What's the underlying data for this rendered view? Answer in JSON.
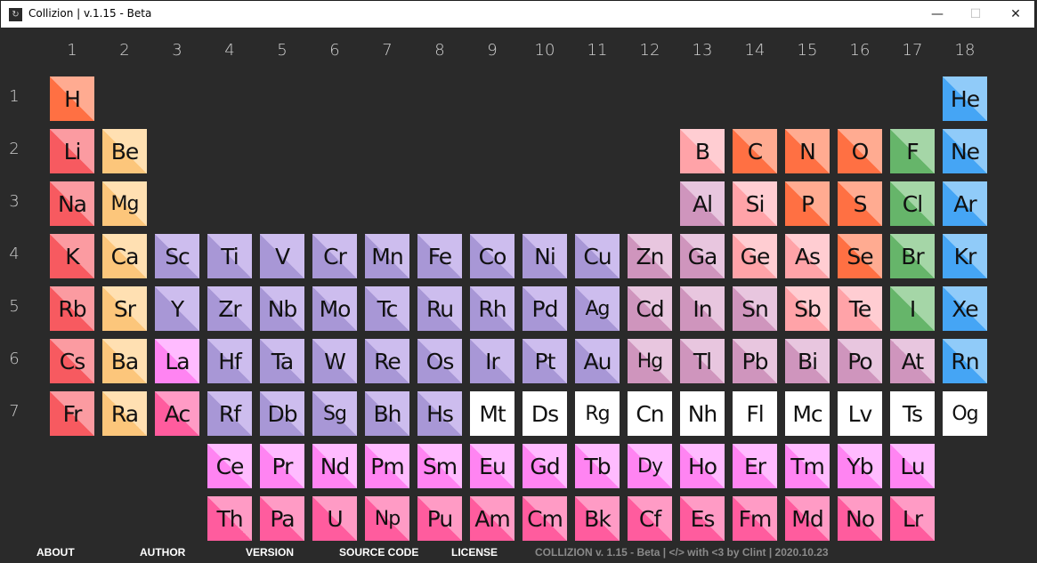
{
  "window": {
    "title": "Collizion | v.1.15 - Beta",
    "minimize": "—",
    "maximize": "☐",
    "close": "✕"
  },
  "group_labels": [
    "1",
    "2",
    "3",
    "4",
    "5",
    "6",
    "7",
    "8",
    "9",
    "10",
    "11",
    "12",
    "13",
    "14",
    "15",
    "16",
    "17",
    "18"
  ],
  "period_labels": [
    "1",
    "2",
    "3",
    "4",
    "5",
    "6",
    "7"
  ],
  "category_colors": {
    "hydrogen": [
      "#ff7043",
      "#ffab91"
    ],
    "alkali": [
      "#f75a60",
      "#fb9ba1"
    ],
    "alkaline": [
      "#fcc67b",
      "#ffe0b2"
    ],
    "transition": [
      "#a897d6",
      "#cdbdee"
    ],
    "post": [
      "#cf95bd",
      "#e8c6df"
    ],
    "metalloid": [
      "#ffa3a8",
      "#ffcdd2"
    ],
    "nonmetal": [
      "#ff7043",
      "#ffab91"
    ],
    "halogen": [
      "#66b56a",
      "#a5d6a7"
    ],
    "noble": [
      "#45a5f5",
      "#90cbf9"
    ],
    "lanthanide": [
      "#ff84f2",
      "#ffbbff"
    ],
    "actinide": [
      "#ff5c9e",
      "#ff9bc5"
    ],
    "unknown": [
      "#ffffff",
      "#ffffff"
    ]
  },
  "elements": [
    {
      "s": "H",
      "r": 1,
      "c": 1,
      "cat": "hydrogen"
    },
    {
      "s": "He",
      "r": 1,
      "c": 18,
      "cat": "noble"
    },
    {
      "s": "Li",
      "r": 2,
      "c": 1,
      "cat": "alkali"
    },
    {
      "s": "Be",
      "r": 2,
      "c": 2,
      "cat": "alkaline"
    },
    {
      "s": "B",
      "r": 2,
      "c": 13,
      "cat": "metalloid"
    },
    {
      "s": "C",
      "r": 2,
      "c": 14,
      "cat": "nonmetal"
    },
    {
      "s": "N",
      "r": 2,
      "c": 15,
      "cat": "nonmetal"
    },
    {
      "s": "O",
      "r": 2,
      "c": 16,
      "cat": "nonmetal"
    },
    {
      "s": "F",
      "r": 2,
      "c": 17,
      "cat": "halogen"
    },
    {
      "s": "Ne",
      "r": 2,
      "c": 18,
      "cat": "noble"
    },
    {
      "s": "Na",
      "r": 3,
      "c": 1,
      "cat": "alkali"
    },
    {
      "s": "Mg",
      "r": 3,
      "c": 2,
      "cat": "alkaline"
    },
    {
      "s": "Al",
      "r": 3,
      "c": 13,
      "cat": "post"
    },
    {
      "s": "Si",
      "r": 3,
      "c": 14,
      "cat": "metalloid"
    },
    {
      "s": "P",
      "r": 3,
      "c": 15,
      "cat": "nonmetal"
    },
    {
      "s": "S",
      "r": 3,
      "c": 16,
      "cat": "nonmetal"
    },
    {
      "s": "Cl",
      "r": 3,
      "c": 17,
      "cat": "halogen"
    },
    {
      "s": "Ar",
      "r": 3,
      "c": 18,
      "cat": "noble"
    },
    {
      "s": "K",
      "r": 4,
      "c": 1,
      "cat": "alkali"
    },
    {
      "s": "Ca",
      "r": 4,
      "c": 2,
      "cat": "alkaline"
    },
    {
      "s": "Sc",
      "r": 4,
      "c": 3,
      "cat": "transition"
    },
    {
      "s": "Ti",
      "r": 4,
      "c": 4,
      "cat": "transition"
    },
    {
      "s": "V",
      "r": 4,
      "c": 5,
      "cat": "transition"
    },
    {
      "s": "Cr",
      "r": 4,
      "c": 6,
      "cat": "transition"
    },
    {
      "s": "Mn",
      "r": 4,
      "c": 7,
      "cat": "transition"
    },
    {
      "s": "Fe",
      "r": 4,
      "c": 8,
      "cat": "transition"
    },
    {
      "s": "Co",
      "r": 4,
      "c": 9,
      "cat": "transition"
    },
    {
      "s": "Ni",
      "r": 4,
      "c": 10,
      "cat": "transition"
    },
    {
      "s": "Cu",
      "r": 4,
      "c": 11,
      "cat": "transition"
    },
    {
      "s": "Zn",
      "r": 4,
      "c": 12,
      "cat": "post"
    },
    {
      "s": "Ga",
      "r": 4,
      "c": 13,
      "cat": "post"
    },
    {
      "s": "Ge",
      "r": 4,
      "c": 14,
      "cat": "metalloid"
    },
    {
      "s": "As",
      "r": 4,
      "c": 15,
      "cat": "metalloid"
    },
    {
      "s": "Se",
      "r": 4,
      "c": 16,
      "cat": "nonmetal"
    },
    {
      "s": "Br",
      "r": 4,
      "c": 17,
      "cat": "halogen"
    },
    {
      "s": "Kr",
      "r": 4,
      "c": 18,
      "cat": "noble"
    },
    {
      "s": "Rb",
      "r": 5,
      "c": 1,
      "cat": "alkali"
    },
    {
      "s": "Sr",
      "r": 5,
      "c": 2,
      "cat": "alkaline"
    },
    {
      "s": "Y",
      "r": 5,
      "c": 3,
      "cat": "transition"
    },
    {
      "s": "Zr",
      "r": 5,
      "c": 4,
      "cat": "transition"
    },
    {
      "s": "Nb",
      "r": 5,
      "c": 5,
      "cat": "transition"
    },
    {
      "s": "Mo",
      "r": 5,
      "c": 6,
      "cat": "transition"
    },
    {
      "s": "Tc",
      "r": 5,
      "c": 7,
      "cat": "transition"
    },
    {
      "s": "Ru",
      "r": 5,
      "c": 8,
      "cat": "transition"
    },
    {
      "s": "Rh",
      "r": 5,
      "c": 9,
      "cat": "transition"
    },
    {
      "s": "Pd",
      "r": 5,
      "c": 10,
      "cat": "transition"
    },
    {
      "s": "Ag",
      "r": 5,
      "c": 11,
      "cat": "transition"
    },
    {
      "s": "Cd",
      "r": 5,
      "c": 12,
      "cat": "post"
    },
    {
      "s": "In",
      "r": 5,
      "c": 13,
      "cat": "post"
    },
    {
      "s": "Sn",
      "r": 5,
      "c": 14,
      "cat": "post"
    },
    {
      "s": "Sb",
      "r": 5,
      "c": 15,
      "cat": "metalloid"
    },
    {
      "s": "Te",
      "r": 5,
      "c": 16,
      "cat": "metalloid"
    },
    {
      "s": "I",
      "r": 5,
      "c": 17,
      "cat": "halogen"
    },
    {
      "s": "Xe",
      "r": 5,
      "c": 18,
      "cat": "noble"
    },
    {
      "s": "Cs",
      "r": 6,
      "c": 1,
      "cat": "alkali"
    },
    {
      "s": "Ba",
      "r": 6,
      "c": 2,
      "cat": "alkaline"
    },
    {
      "s": "La",
      "r": 6,
      "c": 3,
      "cat": "lanthanide"
    },
    {
      "s": "Hf",
      "r": 6,
      "c": 4,
      "cat": "transition"
    },
    {
      "s": "Ta",
      "r": 6,
      "c": 5,
      "cat": "transition"
    },
    {
      "s": "W",
      "r": 6,
      "c": 6,
      "cat": "transition"
    },
    {
      "s": "Re",
      "r": 6,
      "c": 7,
      "cat": "transition"
    },
    {
      "s": "Os",
      "r": 6,
      "c": 8,
      "cat": "transition"
    },
    {
      "s": "Ir",
      "r": 6,
      "c": 9,
      "cat": "transition"
    },
    {
      "s": "Pt",
      "r": 6,
      "c": 10,
      "cat": "transition"
    },
    {
      "s": "Au",
      "r": 6,
      "c": 11,
      "cat": "transition"
    },
    {
      "s": "Hg",
      "r": 6,
      "c": 12,
      "cat": "post"
    },
    {
      "s": "Tl",
      "r": 6,
      "c": 13,
      "cat": "post"
    },
    {
      "s": "Pb",
      "r": 6,
      "c": 14,
      "cat": "post"
    },
    {
      "s": "Bi",
      "r": 6,
      "c": 15,
      "cat": "post"
    },
    {
      "s": "Po",
      "r": 6,
      "c": 16,
      "cat": "post"
    },
    {
      "s": "At",
      "r": 6,
      "c": 17,
      "cat": "post"
    },
    {
      "s": "Rn",
      "r": 6,
      "c": 18,
      "cat": "noble"
    },
    {
      "s": "Fr",
      "r": 7,
      "c": 1,
      "cat": "alkali"
    },
    {
      "s": "Ra",
      "r": 7,
      "c": 2,
      "cat": "alkaline"
    },
    {
      "s": "Ac",
      "r": 7,
      "c": 3,
      "cat": "actinide"
    },
    {
      "s": "Rf",
      "r": 7,
      "c": 4,
      "cat": "transition"
    },
    {
      "s": "Db",
      "r": 7,
      "c": 5,
      "cat": "transition"
    },
    {
      "s": "Sg",
      "r": 7,
      "c": 6,
      "cat": "transition"
    },
    {
      "s": "Bh",
      "r": 7,
      "c": 7,
      "cat": "transition"
    },
    {
      "s": "Hs",
      "r": 7,
      "c": 8,
      "cat": "transition"
    },
    {
      "s": "Mt",
      "r": 7,
      "c": 9,
      "cat": "unknown"
    },
    {
      "s": "Ds",
      "r": 7,
      "c": 10,
      "cat": "unknown"
    },
    {
      "s": "Rg",
      "r": 7,
      "c": 11,
      "cat": "unknown"
    },
    {
      "s": "Cn",
      "r": 7,
      "c": 12,
      "cat": "unknown"
    },
    {
      "s": "Nh",
      "r": 7,
      "c": 13,
      "cat": "unknown"
    },
    {
      "s": "Fl",
      "r": 7,
      "c": 14,
      "cat": "unknown"
    },
    {
      "s": "Mc",
      "r": 7,
      "c": 15,
      "cat": "unknown"
    },
    {
      "s": "Lv",
      "r": 7,
      "c": 16,
      "cat": "unknown"
    },
    {
      "s": "Ts",
      "r": 7,
      "c": 17,
      "cat": "unknown"
    },
    {
      "s": "Og",
      "r": 7,
      "c": 18,
      "cat": "unknown"
    },
    {
      "s": "Ce",
      "r": 8,
      "c": 4,
      "cat": "lanthanide"
    },
    {
      "s": "Pr",
      "r": 8,
      "c": 5,
      "cat": "lanthanide"
    },
    {
      "s": "Nd",
      "r": 8,
      "c": 6,
      "cat": "lanthanide"
    },
    {
      "s": "Pm",
      "r": 8,
      "c": 7,
      "cat": "lanthanide"
    },
    {
      "s": "Sm",
      "r": 8,
      "c": 8,
      "cat": "lanthanide"
    },
    {
      "s": "Eu",
      "r": 8,
      "c": 9,
      "cat": "lanthanide"
    },
    {
      "s": "Gd",
      "r": 8,
      "c": 10,
      "cat": "lanthanide"
    },
    {
      "s": "Tb",
      "r": 8,
      "c": 11,
      "cat": "lanthanide"
    },
    {
      "s": "Dy",
      "r": 8,
      "c": 12,
      "cat": "lanthanide"
    },
    {
      "s": "Ho",
      "r": 8,
      "c": 13,
      "cat": "lanthanide"
    },
    {
      "s": "Er",
      "r": 8,
      "c": 14,
      "cat": "lanthanide"
    },
    {
      "s": "Tm",
      "r": 8,
      "c": 15,
      "cat": "lanthanide"
    },
    {
      "s": "Yb",
      "r": 8,
      "c": 16,
      "cat": "lanthanide"
    },
    {
      "s": "Lu",
      "r": 8,
      "c": 17,
      "cat": "lanthanide"
    },
    {
      "s": "Th",
      "r": 9,
      "c": 4,
      "cat": "actinide"
    },
    {
      "s": "Pa",
      "r": 9,
      "c": 5,
      "cat": "actinide"
    },
    {
      "s": "U",
      "r": 9,
      "c": 6,
      "cat": "actinide"
    },
    {
      "s": "Np",
      "r": 9,
      "c": 7,
      "cat": "actinide"
    },
    {
      "s": "Pu",
      "r": 9,
      "c": 8,
      "cat": "actinide"
    },
    {
      "s": "Am",
      "r": 9,
      "c": 9,
      "cat": "actinide"
    },
    {
      "s": "Cm",
      "r": 9,
      "c": 10,
      "cat": "actinide"
    },
    {
      "s": "Bk",
      "r": 9,
      "c": 11,
      "cat": "actinide"
    },
    {
      "s": "Cf",
      "r": 9,
      "c": 12,
      "cat": "actinide"
    },
    {
      "s": "Es",
      "r": 9,
      "c": 13,
      "cat": "actinide"
    },
    {
      "s": "Fm",
      "r": 9,
      "c": 14,
      "cat": "actinide"
    },
    {
      "s": "Md",
      "r": 9,
      "c": 15,
      "cat": "actinide"
    },
    {
      "s": "No",
      "r": 9,
      "c": 16,
      "cat": "actinide"
    },
    {
      "s": "Lr",
      "r": 9,
      "c": 17,
      "cat": "actinide"
    }
  ],
  "footer": {
    "about": "ABOUT",
    "author": "AUTHOR",
    "version": "VERSION",
    "source_code": "SOURCE CODE",
    "license": "LICENSE",
    "info": "COLLIZION v. 1.15 - Beta | </> with <3 by Clint | 2020.10.23"
  }
}
